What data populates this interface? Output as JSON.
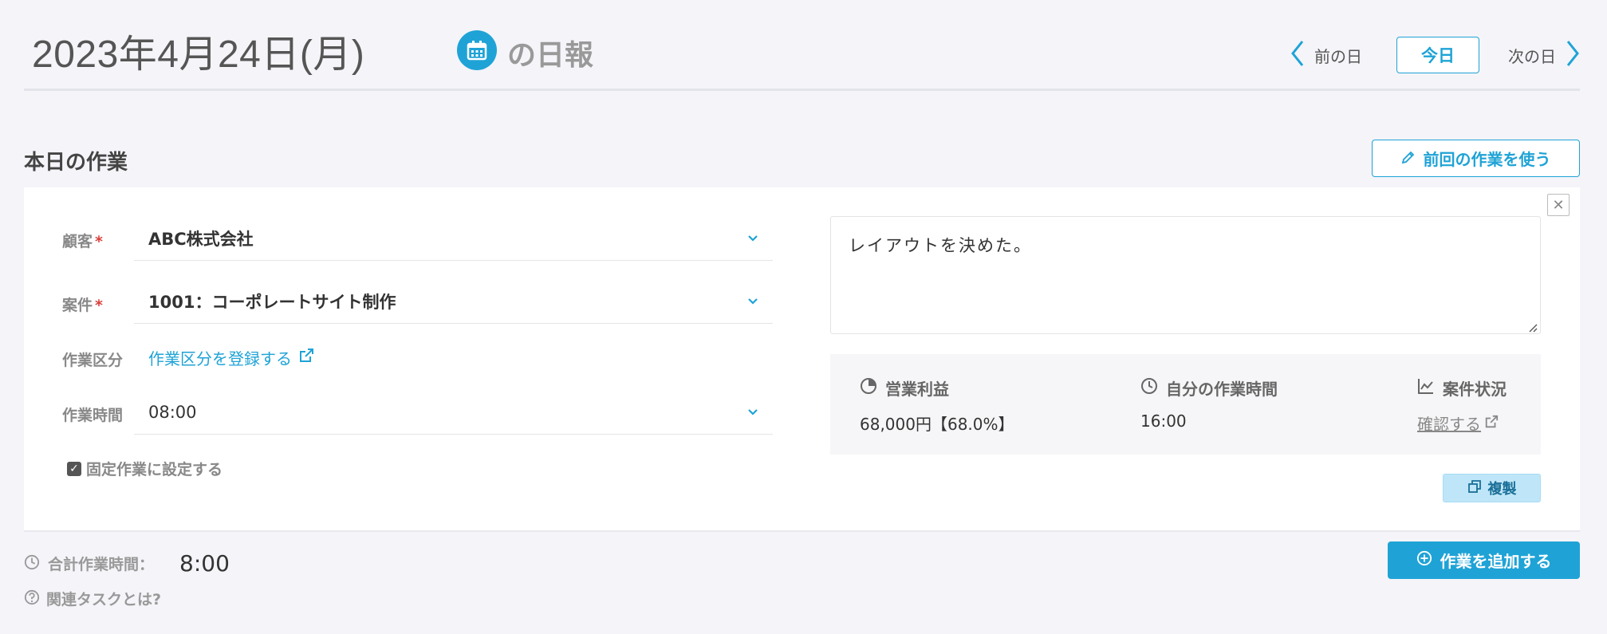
{
  "header": {
    "date": "2023年4月24日(月)",
    "title": "の日報",
    "prev_label": "前の日",
    "today_label": "今日",
    "next_label": "次の日"
  },
  "section": {
    "title": "本日の作業",
    "prev_work_label": "前回の作業を使う"
  },
  "form": {
    "customer": {
      "label": "顧客",
      "required_mark": "*",
      "value": "ABC株式会社"
    },
    "project": {
      "label": "案件",
      "required_mark": "*",
      "value": "1001：コーポレートサイト制作"
    },
    "category": {
      "label": "作業区分",
      "link": "作業区分を登録する"
    },
    "time": {
      "label": "作業時間",
      "value": "08:00"
    },
    "fixed_checkbox": {
      "label": "固定作業に設定する",
      "checked": true
    },
    "memo": "レイアウトを決めた。"
  },
  "stats": {
    "profit": {
      "label": "営業利益",
      "value": "68,000円【68.0%】"
    },
    "my_time": {
      "label": "自分の作業時間",
      "value": "16:00"
    },
    "project_status": {
      "label": "案件状況",
      "link": "確認する"
    }
  },
  "duplicate_label": "複製",
  "footer": {
    "total_label": "合計作業時間：",
    "total_value": "8:00",
    "help_label": "関連タスクとは?",
    "add_label": "作業を追加する"
  },
  "colors": {
    "accent": "#1fa3d6",
    "required": "#d9413d",
    "background": "#f4f4f9"
  }
}
